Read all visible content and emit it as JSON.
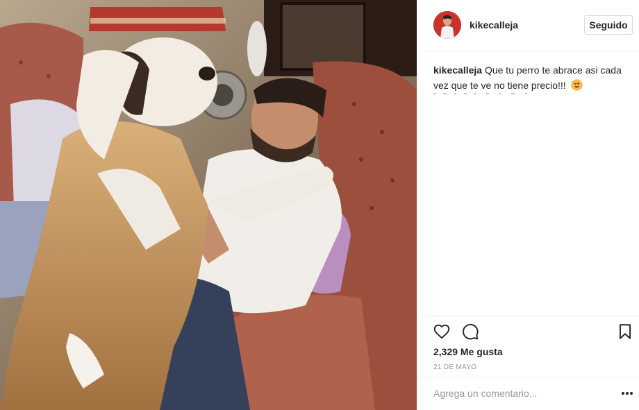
{
  "post": {
    "photo_alt": "",
    "author": {
      "username": "kikecalleja"
    },
    "follow_label": "Seguido",
    "caption": {
      "username": "kikecalleja",
      "text": "Que tu perro te abrace asi cada vez que te ve no tiene precio!!!"
    },
    "likes_text": "2,329 Me gusta",
    "date_text": "21 DE MAYO",
    "comment": {
      "placeholder": "Agrega un comentario...",
      "value": ""
    }
  },
  "icons": {
    "like": "heart-icon",
    "comment": "comment-icon",
    "save": "bookmark-icon",
    "options": "more-options-icon",
    "emoji": "heart-eyes-emoji-icon"
  },
  "colors": {
    "text": "#262626",
    "muted": "#999999",
    "border": "#efefef",
    "button_border": "#dbdbdb"
  }
}
